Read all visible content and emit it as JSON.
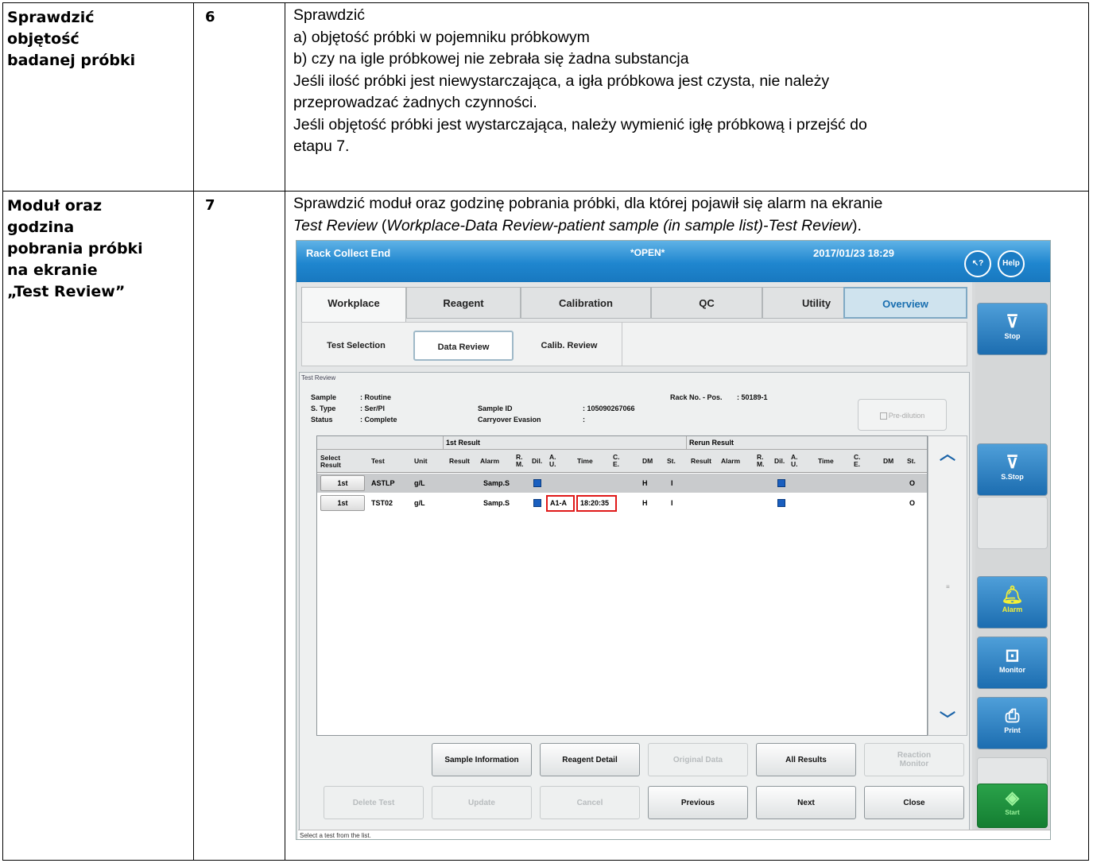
{
  "rows": [
    {
      "heading": [
        "Sprawdzić",
        "objętość",
        "badanej próbki"
      ],
      "step": "6",
      "lines": [
        "Sprawdzić",
        "a) objętość próbki w pojemniku próbkowym",
        "b) czy na igle próbkowej nie zebrała się żadna substancja",
        "Jeśli ilość próbki jest niewystarczająca, a igła próbkowa jest czysta, nie należy",
        "przeprowadzać żadnych czynności.",
        "Jeśli objętość próbki jest wystarczająca, należy wymienić igłę próbkową i przejść do",
        "etapu 7."
      ]
    },
    {
      "heading": [
        "Moduł oraz",
        "godzina",
        "pobrania próbki",
        "na ekranie",
        "„Test Review”"
      ],
      "step": "7",
      "line1": "Sprawdzić moduł oraz godzinę pobrania próbki, dla której pojawił się alarm na ekranie",
      "line2_italic_a": "Test Review",
      "line2_plain_a": "  (",
      "line2_italic_b": "Workplace-Data Review-patient sample (in sample list)-Test Review",
      "line2_plain_b": ")."
    }
  ],
  "screen": {
    "title": "Rack Collect End",
    "mode": "*OPEN*",
    "datetime": "2017/01/23   18:29",
    "help_arrow_label": "↖?",
    "help_label": "Help",
    "tabs": [
      "Workplace",
      "Reagent",
      "Calibration",
      "QC",
      "Utility",
      "Overview"
    ],
    "subtabs": [
      "Test Selection",
      "Data Review",
      "Calib. Review"
    ],
    "panel_title": "Test Review",
    "info": {
      "sample_label": "Sample",
      "sample_value": ":  Routine",
      "stype_label": "S. Type",
      "stype_value": ":  Ser/Pl",
      "status_label": "Status",
      "status_value": ":  Complete",
      "sampleid_label": "Sample ID",
      "sampleid_value": ":  105090267066",
      "carry_label": "Carryover Evasion",
      "carry_value": ":",
      "rack_label": "Rack No. - Pos.",
      "rack_value": ":    50189-1"
    },
    "prediltion_label": "Pre-dilution",
    "groups": {
      "first": "1st Result",
      "rerun": "Rerun Result"
    },
    "columns": {
      "select": "Select\nResult",
      "test": "Test",
      "unit": "Unit",
      "result": "Result",
      "alarm": "Alarm",
      "rm": "R.\nM.",
      "dil": "Dil.",
      "au": "A.\nU.",
      "time": "Time",
      "ce": "C.\nE.",
      "dm": "DM",
      "st": "St.",
      "rresult": "Result",
      "ralarm": "Alarm",
      "rrm": "R.\nM.",
      "rdil": "Dil.",
      "rau": "A.\nU.",
      "rtime": "Time",
      "rce": "C.\nE.",
      "rdm": "DM",
      "rst": "St."
    },
    "results": [
      {
        "select": "1st",
        "test": "ASTLP",
        "unit": "g/L",
        "alarm": "Samp.S",
        "au": "",
        "time": "",
        "dm": "H",
        "st": "I",
        "rst": "O"
      },
      {
        "select": "1st",
        "test": "TST02",
        "unit": "g/L",
        "alarm": "Samp.S",
        "au": "A1-A",
        "time": "18:20:35",
        "dm": "H",
        "st": "I",
        "rst": "O"
      }
    ],
    "buttons_row1": [
      "Sample Information",
      "Reagent Detail",
      "Original Data",
      "All Results",
      "Reaction\nMonitor"
    ],
    "buttons_row2": [
      "Delete Test",
      "Update",
      "Cancel",
      "Previous",
      "Next",
      "Close"
    ],
    "side_buttons": {
      "stop": "Stop",
      "sstop": "S.Stop",
      "alarm": "Alarm",
      "monitor": "Monitor",
      "print": "Print",
      "start": "Start"
    },
    "status_text": "Select a test from the list."
  }
}
